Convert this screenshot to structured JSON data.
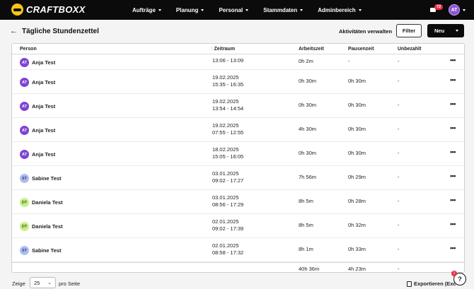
{
  "brand": {
    "name": "CRAFTBOXX"
  },
  "nav": {
    "items": [
      {
        "label": "Aufträge"
      },
      {
        "label": "Planung"
      },
      {
        "label": "Personal"
      },
      {
        "label": "Stammdaten"
      },
      {
        "label": "Adminbereich"
      }
    ],
    "messages_badge": "72",
    "user_initials": "AT"
  },
  "header": {
    "back_icon": "arrow-left-icon",
    "title": "Tägliche Stundenzettel",
    "activities_label": "Aktivitäten verwalten",
    "filter_label": "Filter",
    "new_label": "Neu"
  },
  "table": {
    "columns": {
      "person": "Person",
      "zeitraum": "Zeitraum",
      "arbeitszeit": "Arbeitszeit",
      "pausenzeit": "Pausenzeit",
      "unbezahlt": "Unbezahlt"
    },
    "rows": [
      {
        "initials": "AT",
        "name": "Anja Test",
        "date": "",
        "time": "13:06 - 13:09",
        "work": "0h 2m",
        "pause": "-",
        "unpaid": "-",
        "avatar_bg": "#7e44d4",
        "avatar_fg": "#ffffff",
        "partial": true
      },
      {
        "initials": "AT",
        "name": "Anja Test",
        "date": "19.02.2025",
        "time": "15:35 - 16:35",
        "work": "0h 30m",
        "pause": "0h 30m",
        "unpaid": "-",
        "avatar_bg": "#7e44d4",
        "avatar_fg": "#ffffff"
      },
      {
        "initials": "AT",
        "name": "Anja Test",
        "date": "19.02.2025",
        "time": "13:54 - 14:54",
        "work": "0h 30m",
        "pause": "0h 30m",
        "unpaid": "-",
        "avatar_bg": "#7e44d4",
        "avatar_fg": "#ffffff"
      },
      {
        "initials": "AT",
        "name": "Anja Test",
        "date": "19.02.2025",
        "time": "07:55 - 12:55",
        "work": "4h 30m",
        "pause": "0h 30m",
        "unpaid": "-",
        "avatar_bg": "#7e44d4",
        "avatar_fg": "#ffffff"
      },
      {
        "initials": "AT",
        "name": "Anja Test",
        "date": "18.02.2025",
        "time": "15:05 - 16:05",
        "work": "0h 30m",
        "pause": "0h 30m",
        "unpaid": "-",
        "avatar_bg": "#7e44d4",
        "avatar_fg": "#ffffff"
      },
      {
        "initials": "ST",
        "name": "Sabine Test",
        "date": "03.01.2025",
        "time": "09:02 - 17:27",
        "work": "7h 56m",
        "pause": "0h 29m",
        "unpaid": "-",
        "avatar_bg": "#aebdf0",
        "avatar_fg": "#2b3c7a"
      },
      {
        "initials": "DT",
        "name": "Daniela Test",
        "date": "03.01.2025",
        "time": "08:56 - 17:29",
        "work": "8h 5m",
        "pause": "0h 28m",
        "unpaid": "-",
        "avatar_bg": "#c8ef8a",
        "avatar_fg": "#3a5a10"
      },
      {
        "initials": "DT",
        "name": "Daniela Test",
        "date": "02.01.2025",
        "time": "09:02 - 17:39",
        "work": "8h 5m",
        "pause": "0h 32m",
        "unpaid": "-",
        "avatar_bg": "#c8ef8a",
        "avatar_fg": "#3a5a10"
      },
      {
        "initials": "ST",
        "name": "Sabine Test",
        "date": "02.01.2025",
        "time": "08:58 - 17:32",
        "work": "8h 1m",
        "pause": "0h 33m",
        "unpaid": "-",
        "avatar_bg": "#aebdf0",
        "avatar_fg": "#2b3c7a"
      }
    ],
    "totals": {
      "work": "40h 36m",
      "pause": "4h 23m",
      "unpaid": "-"
    }
  },
  "footer": {
    "show_label": "Zeige",
    "page_size": "25",
    "per_page_label": "pro Seite",
    "export_label": "Exportieren (Exc",
    "help_label": "?",
    "help_badge": "1"
  },
  "colors": {
    "navbar": "#0b0b0b",
    "accent_sort": "#e2a300",
    "badge": "#e4324a"
  }
}
